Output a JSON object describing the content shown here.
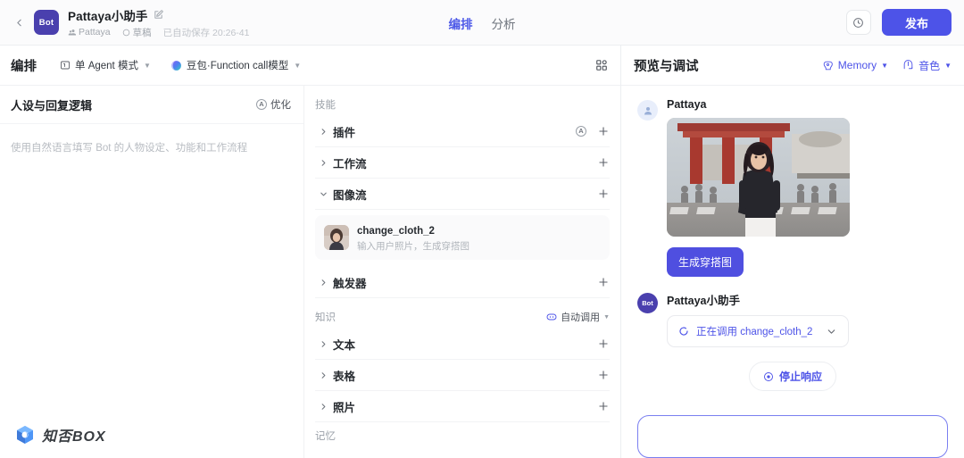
{
  "topbar": {
    "back_icon": "chevron-left-icon",
    "bot_badge": "Bot",
    "bot_title": "Pattaya小助手",
    "edit_icon": "edit-square-icon",
    "owner": "Pattaya",
    "status": "草稿",
    "autosave": "已自动保存 20:26-41",
    "tabs": [
      {
        "label": "编排",
        "active": true
      },
      {
        "label": "分析",
        "active": false
      }
    ],
    "history_icon": "clock-history-icon",
    "publish_label": "发布",
    "publish_color": "#4d53e8"
  },
  "editor_toolbar": {
    "title": "编排",
    "agent_mode": "单 Agent 模式",
    "agent_mode_icon": "single-agent-icon",
    "model": "豆包·Function call模型",
    "model_icon": "model-orb-icon",
    "layout_icon": "grid-layout-icon"
  },
  "persona": {
    "title": "人设与回复逻辑",
    "optimize_label": "优化",
    "optimize_icon": "circle-a-icon",
    "placeholder": "使用自然语言填写 Bot 的人物设定、功能和工作流程",
    "watermark": "知否BOX",
    "watermark_icon": "cube-logo-icon"
  },
  "skills": {
    "group_title": "技能",
    "rows": [
      {
        "label": "插件",
        "expanded": false,
        "auto_icon": true
      },
      {
        "label": "工作流",
        "expanded": false,
        "auto_icon": false
      },
      {
        "label": "图像流",
        "expanded": true,
        "auto_icon": false
      }
    ],
    "image_flow_item": {
      "name": "change_cloth_2",
      "desc": "输入用户照片，生成穿搭图",
      "thumb": "person-thumbnail"
    },
    "trigger_row": {
      "label": "触发器",
      "expanded": false
    }
  },
  "knowledge": {
    "group_title": "知识",
    "mode_label": "自动调用",
    "mode_icon": "auto-call-icon",
    "rows": [
      {
        "label": "文本"
      },
      {
        "label": "表格"
      },
      {
        "label": "照片"
      }
    ],
    "clipped_group_title": "记忆"
  },
  "preview": {
    "title": "预览与调试",
    "memory_label": "Memory",
    "memory_icon": "memory-brain-icon",
    "voice_label": "音色",
    "voice_icon": "voice-icon",
    "accent": "#4d53e8",
    "messages": [
      {
        "role": "user",
        "avatar_icon": "user-avatar-icon",
        "name": "Pattaya",
        "has_image": true,
        "image_alt": "woman-in-black-top-at-crosswalk-temple",
        "button_label": "生成穿搭图"
      },
      {
        "role": "bot",
        "avatar_icon": "bot-avatar-icon",
        "avatar_text": "Bot",
        "name": "Pattaya小助手",
        "tool_status": "正在调用 change_cloth_2",
        "tool_spinner_icon": "loading-spinner-icon",
        "tool_chevron_icon": "chevron-down-icon"
      }
    ],
    "stop_label": "停止响应",
    "stop_icon": "stop-circle-icon"
  }
}
